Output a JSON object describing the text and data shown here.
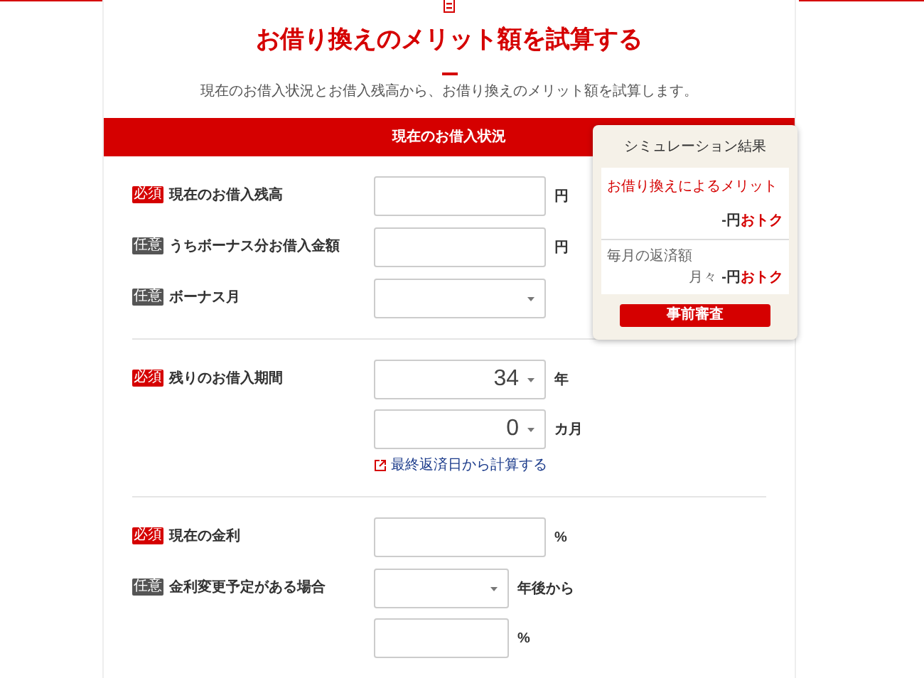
{
  "title": "お借り換えのメリット額を試算する",
  "subtitle": "現在のお借入状況とお借入残高から、お借り換えのメリット額を試算します。",
  "section_header": "現在のお借入状況",
  "groups": [
    {
      "rows": [
        {
          "required": true,
          "badge": "必須",
          "label": "現在のお借入残高",
          "controls": [
            {
              "kind": "input",
              "unit": "円"
            }
          ]
        },
        {
          "required": false,
          "badge": "任意",
          "label": "うちボーナス分お借入金額",
          "controls": [
            {
              "kind": "input",
              "unit": "円"
            }
          ]
        },
        {
          "required": false,
          "badge": "任意",
          "label": "ボーナス月",
          "controls": [
            {
              "kind": "select"
            }
          ]
        }
      ]
    },
    {
      "rows": [
        {
          "required": true,
          "badge": "必須",
          "label": "残りのお借入期間",
          "controls": [
            {
              "kind": "select",
              "value": "34",
              "unit": "年"
            },
            {
              "kind": "select",
              "value": "0",
              "unit": "カ月"
            },
            {
              "kind": "link",
              "text": "最終返済日から計算する"
            }
          ]
        }
      ]
    },
    {
      "rows": [
        {
          "required": true,
          "badge": "必須",
          "label": "現在の金利",
          "controls": [
            {
              "kind": "input",
              "unit": "%"
            }
          ]
        },
        {
          "required": false,
          "badge": "任意",
          "label": "金利変更予定がある場合",
          "controls": [
            {
              "kind": "short_select",
              "unit": "年後から"
            },
            {
              "kind": "short_input",
              "unit": "%"
            }
          ]
        }
      ]
    }
  ],
  "result_panel": {
    "title": "シミュレーション結果",
    "merit": {
      "label": "お借り換えによるメリット",
      "amount": "-円",
      "suffix": "おトク"
    },
    "monthly": {
      "label": "毎月の返済額",
      "prefix": "月々",
      "amount": "-円",
      "suffix": "おトク"
    },
    "button": "事前審査"
  }
}
